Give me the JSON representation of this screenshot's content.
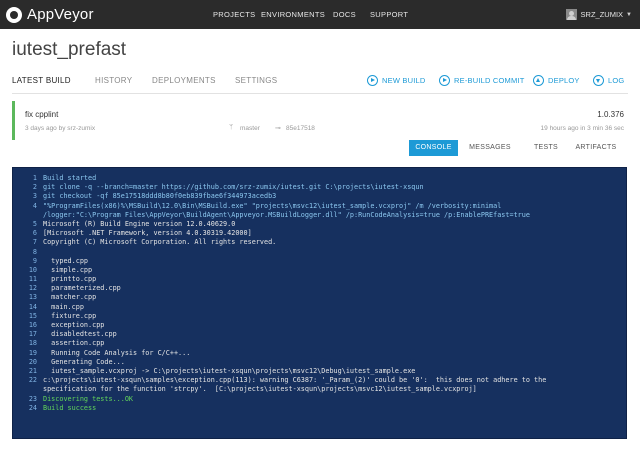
{
  "app": {
    "name": "AppVeyor"
  },
  "nav": {
    "projects": "PROJECTS",
    "environments": "ENVIRONMENTS",
    "docs": "DOCS",
    "support": "SUPPORT"
  },
  "user": {
    "name": "SRZ_ZUMIX"
  },
  "project": {
    "title": "iutest_prefast"
  },
  "subnav": {
    "tabs": [
      "LATEST BUILD",
      "HISTORY",
      "DEPLOYMENTS",
      "SETTINGS"
    ],
    "actions": [
      "NEW BUILD",
      "RE-BUILD COMMIT",
      "DEPLOY",
      "LOG"
    ]
  },
  "build": {
    "message": "fix cpplint",
    "version": "1.0.376",
    "committed": "3 days ago by srz-zumix",
    "branch": "master",
    "commit": "85e17518",
    "time_info": "19 hours ago in 3 min 36 sec",
    "status_color": "#5cb85c"
  },
  "tabs": [
    "CONSOLE",
    "MESSAGES",
    "TESTS",
    "ARTIFACTS"
  ],
  "console": {
    "lines": [
      {
        "n": "1",
        "t": "Build started",
        "c": "cyan"
      },
      {
        "n": "2",
        "t": "git clone -q --branch=master https://github.com/srz-zumix/iutest.git C:\\projects\\iutest-xsqun",
        "c": "cyan"
      },
      {
        "n": "3",
        "t": "git checkout -qf 85e17518ddd8b80f0eb839fbae6f344973acedb3",
        "c": "cyan"
      },
      {
        "n": "4",
        "t": "\"%ProgramFiles(x86)%\\MSBuild\\12.0\\Bin\\MSBuild.exe\" \"projects\\msvc12\\iutest_sample.vcxproj\" /m /verbosity:minimal",
        "c": "cyan"
      },
      {
        "n": "",
        "t": "/logger:\"C:\\Program Files\\AppVeyor\\BuildAgent\\Appveyor.MSBuildLogger.dll\" /p:RunCodeAnalysis=true /p:EnablePREfast=true",
        "c": "cyan"
      },
      {
        "n": "5",
        "t": "Microsoft (R) Build Engine version 12.0.40629.0",
        "c": ""
      },
      {
        "n": "6",
        "t": "[Microsoft .NET Framework, version 4.0.30319.42000]",
        "c": ""
      },
      {
        "n": "7",
        "t": "Copyright (C) Microsoft Corporation. All rights reserved.",
        "c": ""
      },
      {
        "n": "8",
        "t": "",
        "c": ""
      },
      {
        "n": "9",
        "t": "  typed.cpp",
        "c": ""
      },
      {
        "n": "10",
        "t": "  simple.cpp",
        "c": ""
      },
      {
        "n": "11",
        "t": "  printto.cpp",
        "c": ""
      },
      {
        "n": "12",
        "t": "  parameterized.cpp",
        "c": ""
      },
      {
        "n": "13",
        "t": "  matcher.cpp",
        "c": ""
      },
      {
        "n": "14",
        "t": "  main.cpp",
        "c": ""
      },
      {
        "n": "15",
        "t": "  fixture.cpp",
        "c": ""
      },
      {
        "n": "16",
        "t": "  exception.cpp",
        "c": ""
      },
      {
        "n": "17",
        "t": "  disabledtest.cpp",
        "c": ""
      },
      {
        "n": "18",
        "t": "  assertion.cpp",
        "c": ""
      },
      {
        "n": "19",
        "t": "  Running Code Analysis for C/C++...",
        "c": ""
      },
      {
        "n": "20",
        "t": "  Generating Code...",
        "c": ""
      },
      {
        "n": "21",
        "t": "  iutest_sample.vcxproj -> C:\\projects\\iutest-xsqun\\projects\\msvc12\\Debug\\iutest_sample.exe",
        "c": ""
      },
      {
        "n": "22",
        "t": "c:\\projects\\iutest-xsqun\\samples\\exception.cpp(113): warning C6387: '_Param_(2)' could be '0':  this does not adhere to the",
        "c": ""
      },
      {
        "n": "",
        "t": "specification for the function 'strcpy'.  [C:\\projects\\iutest-xsqun\\projects\\msvc12\\iutest_sample.vcxproj]",
        "c": ""
      },
      {
        "n": "23",
        "t": "Discovering tests...OK",
        "c": "green"
      },
      {
        "n": "24",
        "t": "Build success",
        "c": "green"
      }
    ]
  }
}
